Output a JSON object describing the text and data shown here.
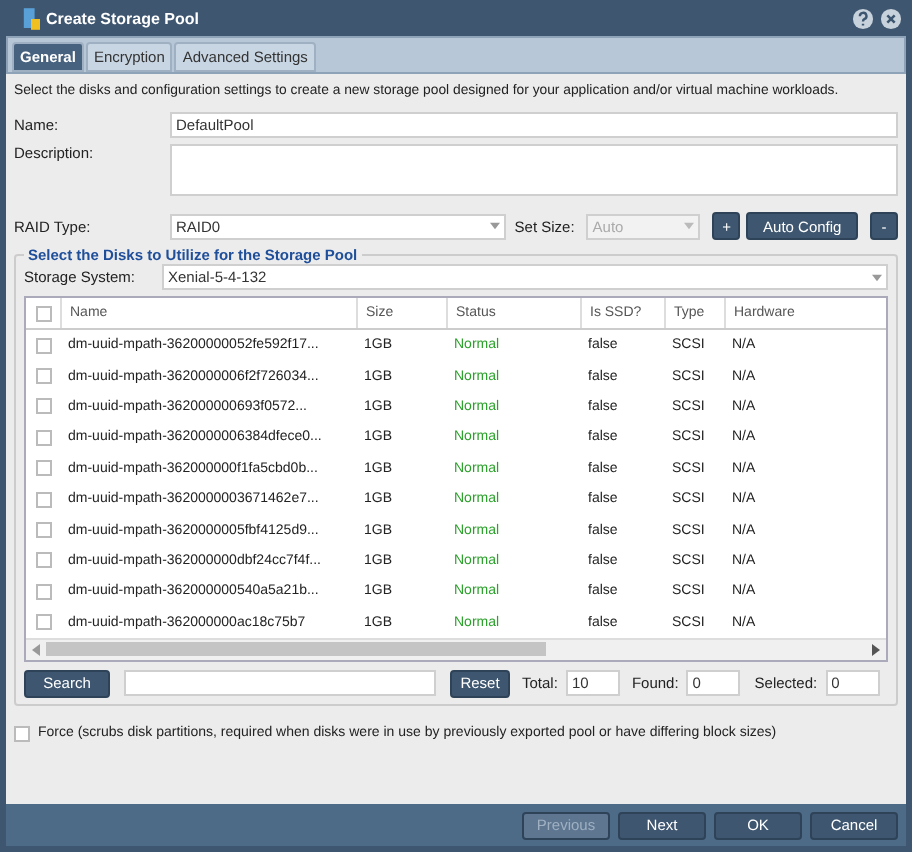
{
  "window": {
    "title": "Create Storage Pool"
  },
  "tabs": [
    {
      "label": "General",
      "selected": true
    },
    {
      "label": "Encryption",
      "selected": false
    },
    {
      "label": "Advanced Settings",
      "selected": false
    }
  ],
  "intro": "Select the disks and configuration settings to create a new storage pool designed for your application and/or virtual machine workloads.",
  "name_field": {
    "label": "Name:",
    "value": "DefaultPool"
  },
  "description_field": {
    "label": "Description:"
  },
  "raid": {
    "label": "RAID Type:",
    "value": "RAID0",
    "set_size_label": "Set Size:",
    "set_size_value": "Auto",
    "set_size_disabled": true,
    "add_button": "+",
    "auto_button": "Auto Config",
    "remove_button": "-"
  },
  "disks": {
    "title": "Select the Disks to Utilize for the Storage Pool",
    "system_label": "Storage System:",
    "system_value": "Xenial-5-4-132",
    "select_all_checked": false,
    "columns": [
      "Name",
      "Size",
      "Status",
      "Is SSD?",
      "Type",
      "Hardware"
    ],
    "rows": [
      {
        "checked": false,
        "cells": [
          "dm-uuid-mpath-36200000052fe592f17...",
          "1GB",
          "Normal",
          "false",
          "SCSI",
          "N/A"
        ]
      },
      {
        "checked": false,
        "cells": [
          "dm-uuid-mpath-3620000006f2f726034...",
          "1GB",
          "Normal",
          "false",
          "SCSI",
          "N/A"
        ]
      },
      {
        "checked": false,
        "cells": [
          "dm-uuid-mpath-362000000693f0572...",
          "1GB",
          "Normal",
          "false",
          "SCSI",
          "N/A"
        ]
      },
      {
        "checked": false,
        "cells": [
          "dm-uuid-mpath-3620000006384dfece0...",
          "1GB",
          "Normal",
          "false",
          "SCSI",
          "N/A"
        ]
      },
      {
        "checked": false,
        "cells": [
          "dm-uuid-mpath-362000000f1fa5cbd0b...",
          "1GB",
          "Normal",
          "false",
          "SCSI",
          "N/A"
        ]
      },
      {
        "checked": false,
        "cells": [
          "dm-uuid-mpath-3620000003671462e7...",
          "1GB",
          "Normal",
          "false",
          "SCSI",
          "N/A"
        ]
      },
      {
        "checked": false,
        "cells": [
          "dm-uuid-mpath-3620000005fbf4125d9...",
          "1GB",
          "Normal",
          "false",
          "SCSI",
          "N/A"
        ]
      },
      {
        "checked": false,
        "cells": [
          "dm-uuid-mpath-362000000dbf24cc7f4f...",
          "1GB",
          "Normal",
          "false",
          "SCSI",
          "N/A"
        ]
      },
      {
        "checked": false,
        "cells": [
          "dm-uuid-mpath-362000000540a5a21b...",
          "1GB",
          "Normal",
          "false",
          "SCSI",
          "N/A"
        ]
      },
      {
        "checked": false,
        "cells": [
          "dm-uuid-mpath-362000000ac18c75b7",
          "1GB",
          "Normal",
          "false",
          "SCSI",
          "N/A"
        ]
      }
    ],
    "search_button": "Search",
    "reset_button": "Reset",
    "total_label": "Total:",
    "total_value": "10",
    "found_label": "Found:",
    "found_value": "0",
    "selected_label": "Selected:",
    "selected_value": "0"
  },
  "force": {
    "checked": false,
    "label": "Force (scrubs disk partitions, required when disks were in use by previously exported pool or have differing block sizes)"
  },
  "buttons": [
    {
      "label": "Previous",
      "disabled": true
    },
    {
      "label": "Next",
      "disabled": false
    },
    {
      "label": "OK",
      "disabled": false
    },
    {
      "label": "Cancel",
      "disabled": false
    }
  ]
}
